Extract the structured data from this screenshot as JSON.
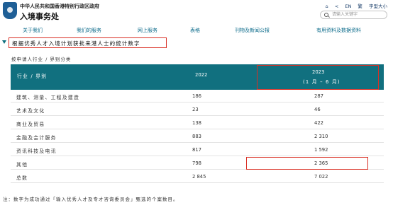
{
  "header": {
    "gov_name": "中华人民共和国香港特别行政区政府",
    "dept_name": "入境事务处",
    "utilities": [
      "⌂",
      "<",
      "EN",
      "繁",
      "字型大小"
    ],
    "search_placeholder": "请输入关键字"
  },
  "nav": {
    "items": [
      "关于我们",
      "我们的服务",
      "网上服务",
      "表格",
      "刊物及新闻公报",
      "有用资料及数据资料"
    ]
  },
  "page": {
    "title": "根据优秀人才入境计划获批来港人士的统计数字",
    "subtitle": "按申请人行业 / 界别分类"
  },
  "table": {
    "headers": {
      "industry": "行业 / 界别",
      "year_2022": "2022",
      "year_2023": "2023",
      "year_2023_note": "(1 月 – 6 月)"
    },
    "rows": [
      {
        "industry": "建筑、测量、工程及建造",
        "y2022": "186",
        "y2023": "287"
      },
      {
        "industry": "艺术及文化",
        "y2022": "23",
        "y2023": "46"
      },
      {
        "industry": "商业及贸易",
        "y2022": "138",
        "y2023": "422"
      },
      {
        "industry": "金融及会计服务",
        "y2022": "883",
        "y2023": "2 310"
      },
      {
        "industry": "资讯科技及电讯",
        "y2022": "817",
        "y2023": "1 592"
      },
      {
        "industry": "其他",
        "y2022": "798",
        "y2023": "2 365"
      },
      {
        "industry": "总数",
        "y2022": "2 845",
        "y2023": "7 022"
      }
    ]
  },
  "footnote": "注：数字为成功通过「输入优秀人才及专才咨询委员会」甄选的个案数目。",
  "colors": {
    "header_bg": "#11707f",
    "nav_text": "#0a6a8a",
    "highlight_border": "#d93025"
  }
}
